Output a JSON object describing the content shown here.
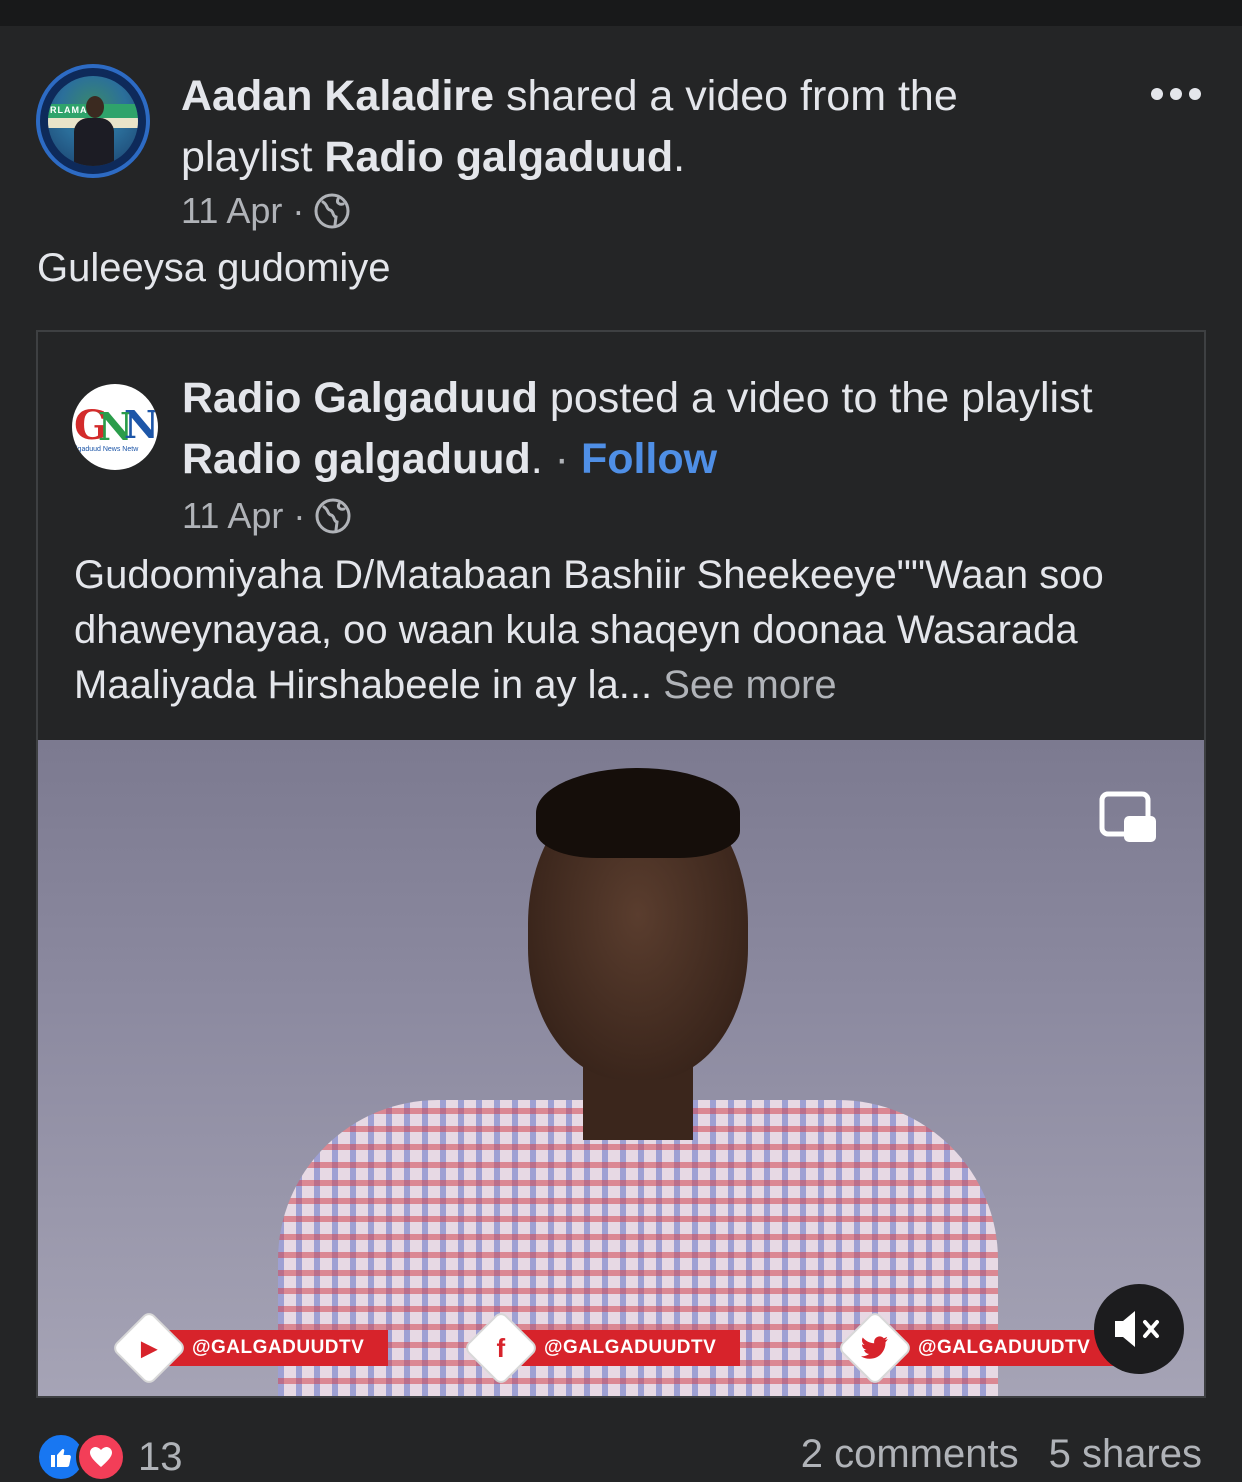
{
  "post": {
    "author": "Aadan Kaladire",
    "action_text": " shared a video from the playlist ",
    "playlist": "Radio galgaduud",
    "period": ".",
    "date": "11 Apr",
    "dot": "·",
    "caption": "Guleeysa gudomiye",
    "more_icon": "more-horizontal-icon",
    "avatar_text": "RLAMA"
  },
  "shared": {
    "author": "Radio Galgaduud",
    "action_text": " posted a video to the playlist ",
    "playlist": "Radio galgaduud",
    "period": ".",
    "sep": " · ",
    "follow_label": "Follow",
    "date": "11 Apr",
    "dot": "·",
    "body": "Gudoomiyaha D/Matabaan Bashiir Sheekeeye\"\"Waan soo dhaweynayaa, oo waan kula shaqeyn doonaa Wasarada Maaliyada Hirshabeele in ay la...",
    "see_more": " See more",
    "logo": {
      "g": "G",
      "n1": "N",
      "n2": "N",
      "sub": "lgaduud News Netw"
    },
    "video": {
      "social": [
        {
          "icon": "youtube-icon",
          "glyph": "▶",
          "label": "@GALGADUUDTV",
          "color": "#d7232b"
        },
        {
          "icon": "facebook-icon",
          "glyph": "f",
          "label": "@GALGADUUDTV",
          "color": "#3b5998"
        },
        {
          "icon": "twitter-icon",
          "glyph": "🐦",
          "label": "@GALGADUUDTV",
          "color": "#1da1f2"
        }
      ]
    }
  },
  "footer": {
    "reaction_count": "13",
    "comments": "2 comments",
    "shares": "5 shares"
  },
  "colors": {
    "background": "#242526",
    "text": "#e4e6eb",
    "secondary_text": "#b0b3b8",
    "link": "#4f8fe6",
    "like": "#1877f2",
    "love": "#f33e58",
    "overlay_red": "#d7232b"
  }
}
